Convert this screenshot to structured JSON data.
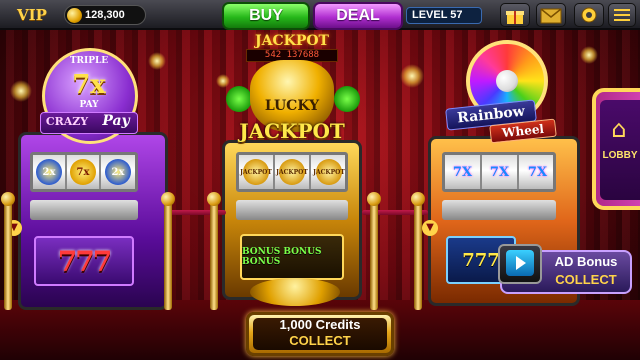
{
  "top_bar": {
    "vip_label": "VIP",
    "coins": "128,300",
    "buy_label": "BUY",
    "deal_label": "DEAL",
    "level": "LEVEL 57",
    "icons": [
      "gift-icon",
      "mail-icon",
      "settings-icon"
    ]
  },
  "machines": [
    {
      "name": "Triple 7x Pay",
      "marquee_lines": [
        "TRIPLE",
        "7x",
        "PAY"
      ],
      "sign_line1": "CRAZY",
      "sign_line2": "Pay",
      "reel_symbols": [
        "2x",
        "7x",
        "2x"
      ],
      "lower_panel": "777",
      "accent_color": "#9a2ed8"
    },
    {
      "name": "Lucky Jackpot",
      "jackpot_label": "JACKPOT",
      "jackpot_value": "542 137688",
      "title_line1": "LUCKY",
      "title_line2": "JACKPOT",
      "reel_symbols": [
        "JACKPOT",
        "JACKPOT",
        "JACKPOT"
      ],
      "lower_panel": "BONUS BONUS BONUS",
      "accent_color": "#d89a10"
    },
    {
      "name": "Rainbow Wheel",
      "title_line1": "Rainbow",
      "title_line2": "Wheel",
      "reel_symbols": [
        "7X",
        "7X",
        "7X"
      ],
      "lower_panel": "777",
      "accent_color": "#ff8a1a"
    }
  ],
  "lobby_label": "LOBBY",
  "collect": {
    "credits": "1,000 Credits",
    "label": "COLLECT"
  },
  "ad_bonus": {
    "title": "AD Bonus",
    "label": "COLLECT"
  },
  "colors": {
    "curtain": "#9a0c14",
    "gold": "#ffd34a",
    "buy_green": "#26b81a",
    "deal_purple": "#b02fd0"
  }
}
